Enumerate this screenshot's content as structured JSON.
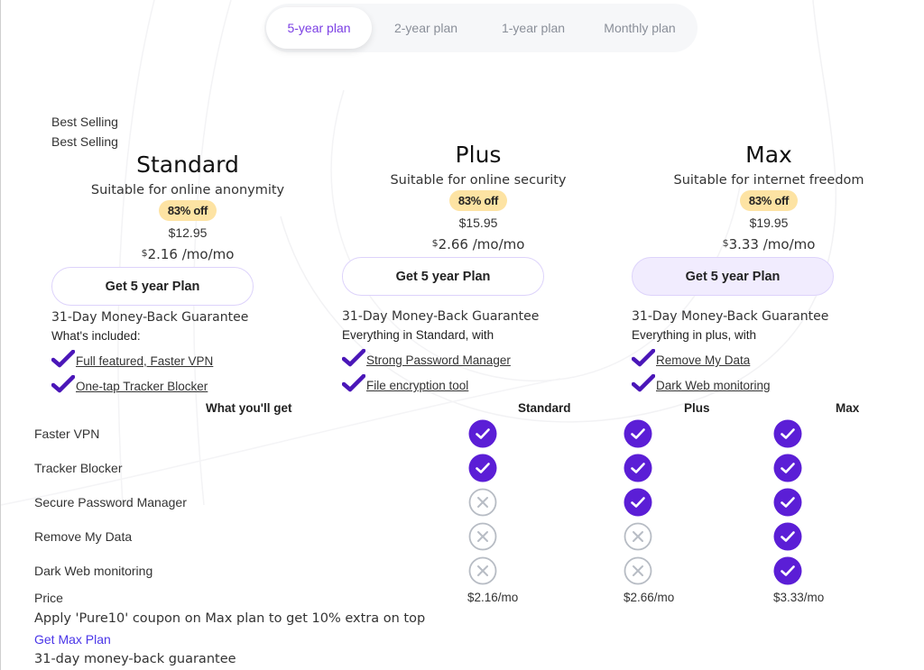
{
  "tabs": [
    {
      "label": "5-year plan",
      "active": true
    },
    {
      "label": "2-year plan",
      "active": false
    },
    {
      "label": "1-year plan",
      "active": false
    },
    {
      "label": "Monthly plan",
      "active": false
    }
  ],
  "best_selling_labels": [
    "Best Selling",
    "Best Selling"
  ],
  "plans": [
    {
      "name": "Standard",
      "subtitle": "Suitable for online anonymity",
      "discount": "83% off",
      "original_price": "$12.95",
      "currency": "$",
      "monthly_price": "2.16 /mo/mo",
      "cta": "Get 5 year Plan",
      "guarantee": "31-Day Money-Back Guarantee",
      "includes_label": "What's included:",
      "features": [
        "Full featured, Faster VPN",
        "One-tap Tracker Blocker"
      ]
    },
    {
      "name": "Plus",
      "subtitle": "Suitable for online security",
      "discount": "83% off",
      "original_price": "$15.95",
      "currency": "$",
      "monthly_price": "2.66 /mo/mo",
      "cta": "Get 5 year Plan",
      "guarantee": "31-Day Money-Back Guarantee",
      "includes_label": "Everything in Standard, with",
      "features": [
        "Strong Password Manager",
        "File encryption tool"
      ]
    },
    {
      "name": "Max",
      "subtitle": "Suitable for internet freedom",
      "discount": "83% off",
      "original_price": "$19.95",
      "currency": "$",
      "monthly_price": "3.33 /mo/mo",
      "cta": "Get 5 year Plan",
      "guarantee": "31-Day Money-Back Guarantee",
      "includes_label": "Everything in plus, with",
      "features": [
        "Remove My Data",
        "Dark Web monitoring"
      ]
    }
  ],
  "comparison": {
    "headers": [
      "What you'll get",
      "Standard",
      "Plus",
      "Max"
    ],
    "rows": [
      {
        "label": "Faster VPN",
        "values": [
          true,
          true,
          true
        ]
      },
      {
        "label": "Tracker Blocker",
        "values": [
          true,
          true,
          true
        ]
      },
      {
        "label": "Secure Password Manager",
        "values": [
          false,
          true,
          true
        ]
      },
      {
        "label": "Remove My Data",
        "values": [
          false,
          false,
          true
        ]
      },
      {
        "label": "Dark Web monitoring",
        "values": [
          false,
          false,
          true
        ]
      }
    ],
    "price_label": "Price",
    "prices": [
      "$2.16/mo",
      "$2.66/mo",
      "$3.33/mo"
    ]
  },
  "coupon_text": "Apply 'Pure10' coupon on Max plan to get 10% extra on top",
  "max_plan_link": "Get Max Plan",
  "footer_guarantee": "31-day money-back guarantee",
  "icons": {
    "included": "check-circle-icon",
    "excluded": "x-circle-icon",
    "feature_tick": "checkmark-icon"
  },
  "colors": {
    "accent": "#5b1ed6",
    "tab_active": "#7b3fe4",
    "badge_bg": "#fde3a3",
    "cta_border": "#ddd3fb",
    "cta_filled_bg": "#f1ecfe",
    "link": "#4a35e8",
    "excluded_icon": "#b7bcc4"
  }
}
